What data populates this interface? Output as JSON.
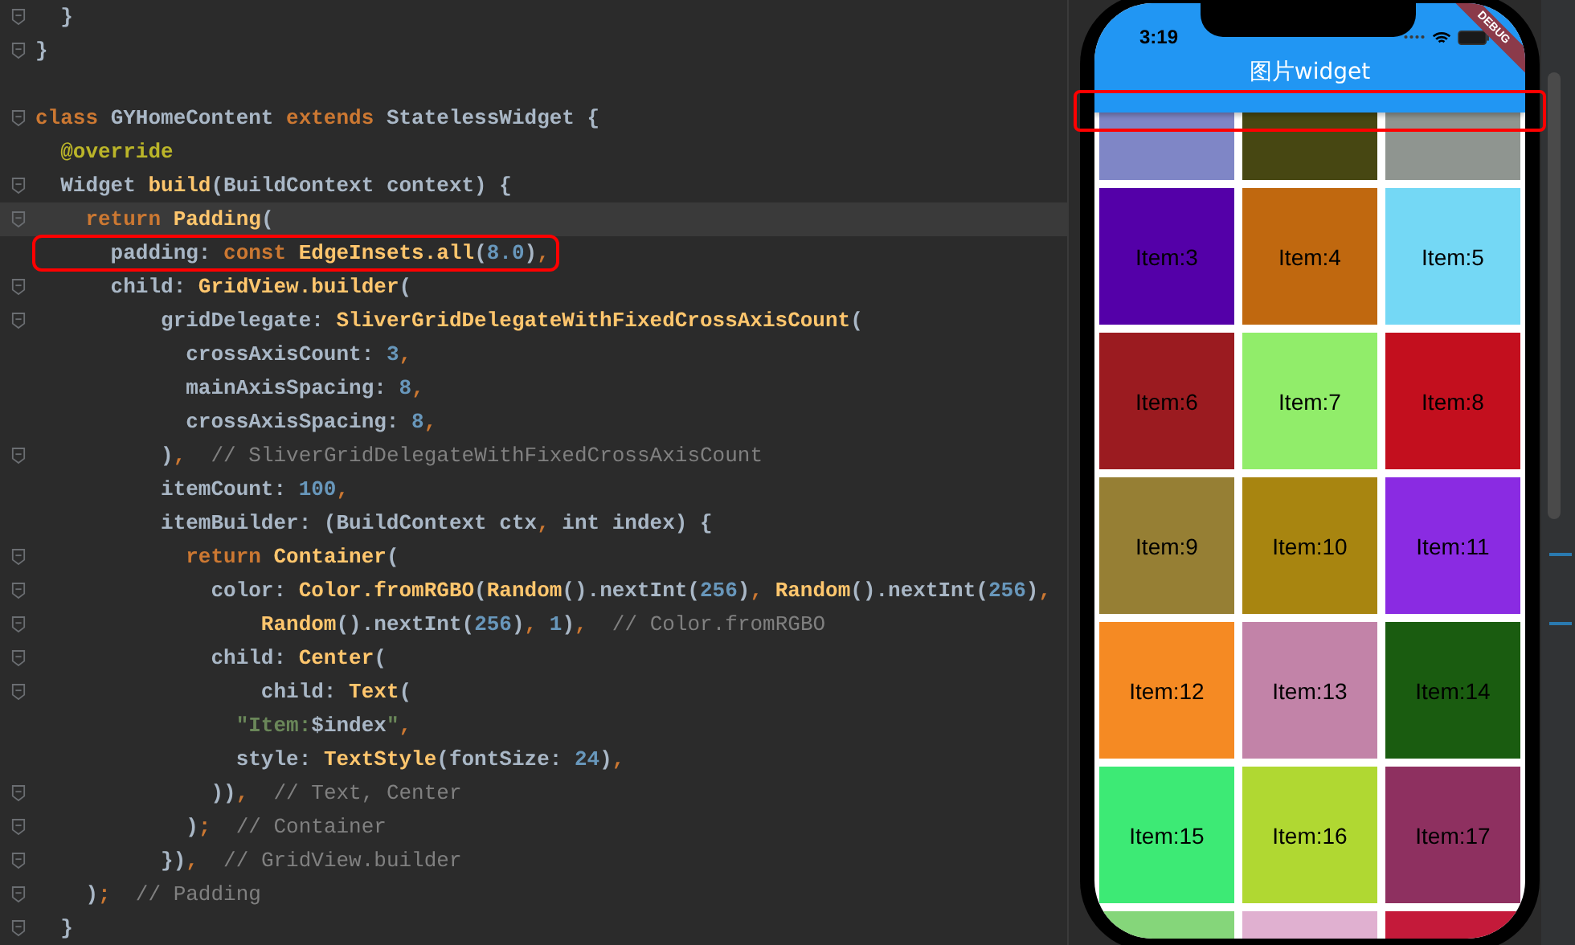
{
  "editor": {
    "lines": [
      {
        "fold": true,
        "current": false,
        "tokens": [
          {
            "kind": "plain",
            "text": "  }"
          }
        ]
      },
      {
        "fold": true,
        "current": false,
        "tokens": [
          {
            "kind": "plain",
            "text": "}"
          }
        ]
      },
      {
        "fold": false,
        "current": false
      },
      {
        "fold": true,
        "current": false,
        "tokens": [
          {
            "kind": "kw",
            "text": "class "
          },
          {
            "kind": "plain",
            "text": "GYHomeContent "
          },
          {
            "kind": "kw",
            "text": "extends "
          },
          {
            "kind": "plain",
            "text": "StatelessWidget {"
          }
        ]
      },
      {
        "fold": false,
        "current": false,
        "tokens": [
          {
            "kind": "ann",
            "text": "  @override"
          }
        ]
      },
      {
        "fold": true,
        "current": false,
        "tokens": [
          {
            "kind": "plain",
            "text": "  Widget "
          },
          {
            "kind": "fn",
            "text": "build"
          },
          {
            "kind": "plain",
            "text": "(BuildContext context) {"
          }
        ]
      },
      {
        "fold": true,
        "current": true,
        "tokens": [
          {
            "kind": "kw",
            "text": "    return "
          },
          {
            "kind": "fn",
            "text": "Padding"
          },
          {
            "kind": "plain",
            "text": "("
          }
        ]
      },
      {
        "fold": false,
        "current": false,
        "highlighted": true,
        "tokens": [
          {
            "kind": "plain",
            "text": "      padding: "
          },
          {
            "kind": "kw",
            "text": "const "
          },
          {
            "kind": "fn",
            "text": "EdgeInsets.all"
          },
          {
            "kind": "plain",
            "text": "("
          },
          {
            "kind": "num",
            "text": "8.0"
          },
          {
            "kind": "plain",
            "text": ")"
          },
          {
            "kind": "kw",
            "text": ","
          }
        ]
      },
      {
        "fold": true,
        "current": false,
        "tokens": [
          {
            "kind": "plain",
            "text": "      child: "
          },
          {
            "kind": "fn",
            "text": "GridView.builder"
          },
          {
            "kind": "plain",
            "text": "("
          }
        ]
      },
      {
        "fold": true,
        "current": false,
        "tokens": [
          {
            "kind": "plain",
            "text": "          gridDelegate: "
          },
          {
            "kind": "fn",
            "text": "SliverGridDelegateWithFixedCrossAxisCount"
          },
          {
            "kind": "plain",
            "text": "("
          }
        ]
      },
      {
        "fold": false,
        "current": false,
        "tokens": [
          {
            "kind": "plain",
            "text": "            crossAxisCount: "
          },
          {
            "kind": "num",
            "text": "3"
          },
          {
            "kind": "kw",
            "text": ","
          }
        ]
      },
      {
        "fold": false,
        "current": false,
        "tokens": [
          {
            "kind": "plain",
            "text": "            mainAxisSpacing: "
          },
          {
            "kind": "num",
            "text": "8"
          },
          {
            "kind": "kw",
            "text": ","
          }
        ]
      },
      {
        "fold": false,
        "current": false,
        "tokens": [
          {
            "kind": "plain",
            "text": "            crossAxisSpacing: "
          },
          {
            "kind": "num",
            "text": "8"
          },
          {
            "kind": "kw",
            "text": ","
          }
        ]
      },
      {
        "fold": true,
        "current": false,
        "tokens": [
          {
            "kind": "plain",
            "text": "          )"
          },
          {
            "kind": "kw",
            "text": ","
          },
          {
            "kind": "cmt",
            "text": "  // SliverGridDelegateWithFixedCrossAxisCount"
          }
        ]
      },
      {
        "fold": false,
        "current": false,
        "tokens": [
          {
            "kind": "plain",
            "text": "          itemCount: "
          },
          {
            "kind": "num",
            "text": "100"
          },
          {
            "kind": "kw",
            "text": ","
          }
        ]
      },
      {
        "fold": false,
        "current": false,
        "tokens": [
          {
            "kind": "plain",
            "text": "          itemBuilder: (BuildContext ctx"
          },
          {
            "kind": "kw",
            "text": ", "
          },
          {
            "kind": "plain",
            "text": "int index) {"
          }
        ]
      },
      {
        "fold": true,
        "current": false,
        "tokens": [
          {
            "kind": "kw",
            "text": "            return "
          },
          {
            "kind": "fn",
            "text": "Container"
          },
          {
            "kind": "plain",
            "text": "("
          }
        ]
      },
      {
        "fold": true,
        "current": false,
        "tokens": [
          {
            "kind": "plain",
            "text": "              color: "
          },
          {
            "kind": "fn",
            "text": "Color.fromRGBO"
          },
          {
            "kind": "plain",
            "text": "("
          },
          {
            "kind": "fn",
            "text": "Random"
          },
          {
            "kind": "plain",
            "text": "().nextInt("
          },
          {
            "kind": "num",
            "text": "256"
          },
          {
            "kind": "plain",
            "text": ")"
          },
          {
            "kind": "kw",
            "text": ", "
          },
          {
            "kind": "fn",
            "text": "Random"
          },
          {
            "kind": "plain",
            "text": "().nextInt("
          },
          {
            "kind": "num",
            "text": "256"
          },
          {
            "kind": "plain",
            "text": ")"
          },
          {
            "kind": "kw",
            "text": ","
          }
        ]
      },
      {
        "fold": true,
        "current": false,
        "tokens": [
          {
            "kind": "fn",
            "text": "                  Random"
          },
          {
            "kind": "plain",
            "text": "().nextInt("
          },
          {
            "kind": "num",
            "text": "256"
          },
          {
            "kind": "plain",
            "text": ")"
          },
          {
            "kind": "kw",
            "text": ", "
          },
          {
            "kind": "num",
            "text": "1"
          },
          {
            "kind": "plain",
            "text": ")"
          },
          {
            "kind": "kw",
            "text": ","
          },
          {
            "kind": "cmt",
            "text": "  // Color.fromRGBO"
          }
        ]
      },
      {
        "fold": true,
        "current": false,
        "tokens": [
          {
            "kind": "plain",
            "text": "              child: "
          },
          {
            "kind": "fn",
            "text": "Center"
          },
          {
            "kind": "plain",
            "text": "("
          }
        ]
      },
      {
        "fold": true,
        "current": false,
        "tokens": [
          {
            "kind": "plain",
            "text": "                  child: "
          },
          {
            "kind": "fn",
            "text": "Text"
          },
          {
            "kind": "plain",
            "text": "("
          }
        ]
      },
      {
        "fold": false,
        "current": false,
        "tokens": [
          {
            "kind": "str",
            "text": "                \"Item:"
          },
          {
            "kind": "plain",
            "text": "$index"
          },
          {
            "kind": "str",
            "text": "\""
          },
          {
            "kind": "kw",
            "text": ","
          }
        ]
      },
      {
        "fold": false,
        "current": false,
        "tokens": [
          {
            "kind": "plain",
            "text": "                style: "
          },
          {
            "kind": "fn",
            "text": "TextStyle"
          },
          {
            "kind": "plain",
            "text": "(fontSize: "
          },
          {
            "kind": "num",
            "text": "24"
          },
          {
            "kind": "plain",
            "text": ")"
          },
          {
            "kind": "kw",
            "text": ","
          }
        ]
      },
      {
        "fold": true,
        "current": false,
        "tokens": [
          {
            "kind": "plain",
            "text": "              ))"
          },
          {
            "kind": "kw",
            "text": ","
          },
          {
            "kind": "cmt",
            "text": "  // Text, Center"
          }
        ]
      },
      {
        "fold": true,
        "current": false,
        "tokens": [
          {
            "kind": "plain",
            "text": "            )"
          },
          {
            "kind": "kw",
            "text": ";"
          },
          {
            "kind": "cmt",
            "text": "  // Container"
          }
        ]
      },
      {
        "fold": true,
        "current": false,
        "tokens": [
          {
            "kind": "plain",
            "text": "          })"
          },
          {
            "kind": "kw",
            "text": ","
          },
          {
            "kind": "cmt",
            "text": "  // GridView.builder"
          }
        ]
      },
      {
        "fold": true,
        "current": false,
        "tokens": [
          {
            "kind": "plain",
            "text": "    )"
          },
          {
            "kind": "kw",
            "text": ";"
          },
          {
            "kind": "cmt",
            "text": "  // Padding"
          }
        ]
      },
      {
        "fold": true,
        "current": false,
        "tokens": [
          {
            "kind": "plain",
            "text": "  }"
          }
        ]
      }
    ]
  },
  "phone": {
    "time": "3:19",
    "debug_banner": "DEBUG",
    "app_bar": {
      "title": "图片widget",
      "highlighted": true
    },
    "tiles": [
      {
        "color": "#7f86c6"
      },
      {
        "color": "#474712"
      },
      {
        "color": "#8f9590"
      },
      {
        "color": "#5400a8",
        "label": "Item:3"
      },
      {
        "color": "#c0680f",
        "label": "Item:4"
      },
      {
        "color": "#74d8f5",
        "label": "Item:5"
      },
      {
        "color": "#9b1b20",
        "label": "Item:6"
      },
      {
        "color": "#91ed6a",
        "label": "Item:7"
      },
      {
        "color": "#c30f1e",
        "label": "Item:8"
      },
      {
        "color": "#967f34",
        "label": "Item:9"
      },
      {
        "color": "#a88510",
        "label": "Item:10"
      },
      {
        "color": "#8a2be2",
        "label": "Item:11"
      },
      {
        "color": "#f58a23",
        "label": "Item:12"
      },
      {
        "color": "#c283a8",
        "label": "Item:13"
      },
      {
        "color": "#1a5c10",
        "label": "Item:14"
      },
      {
        "color": "#3dea75",
        "label": "Item:15"
      },
      {
        "color": "#b0d832",
        "label": "Item:16"
      },
      {
        "color": "#8e3060",
        "label": "Item:17"
      },
      {
        "color": "#85d67a"
      },
      {
        "color": "#e0b0d0"
      },
      {
        "color": "#c41a3a"
      }
    ]
  }
}
